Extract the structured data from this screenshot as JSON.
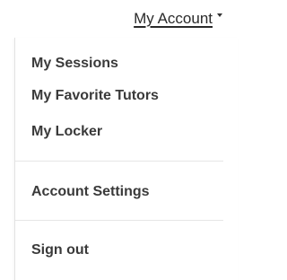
{
  "header": {
    "account_label": "My Account"
  },
  "menu": {
    "group1": [
      {
        "label": "My Sessions"
      },
      {
        "label": "My Favorite Tutors"
      },
      {
        "label": "My Locker"
      }
    ],
    "group2": [
      {
        "label": "Account Settings"
      }
    ],
    "group3": [
      {
        "label": "Sign out"
      }
    ]
  },
  "icons": {
    "account_caret": "chevron-down-icon"
  },
  "colors": {
    "text": "#3a3a3a",
    "divider": "#e6e6e6",
    "background": "#ffffff"
  }
}
